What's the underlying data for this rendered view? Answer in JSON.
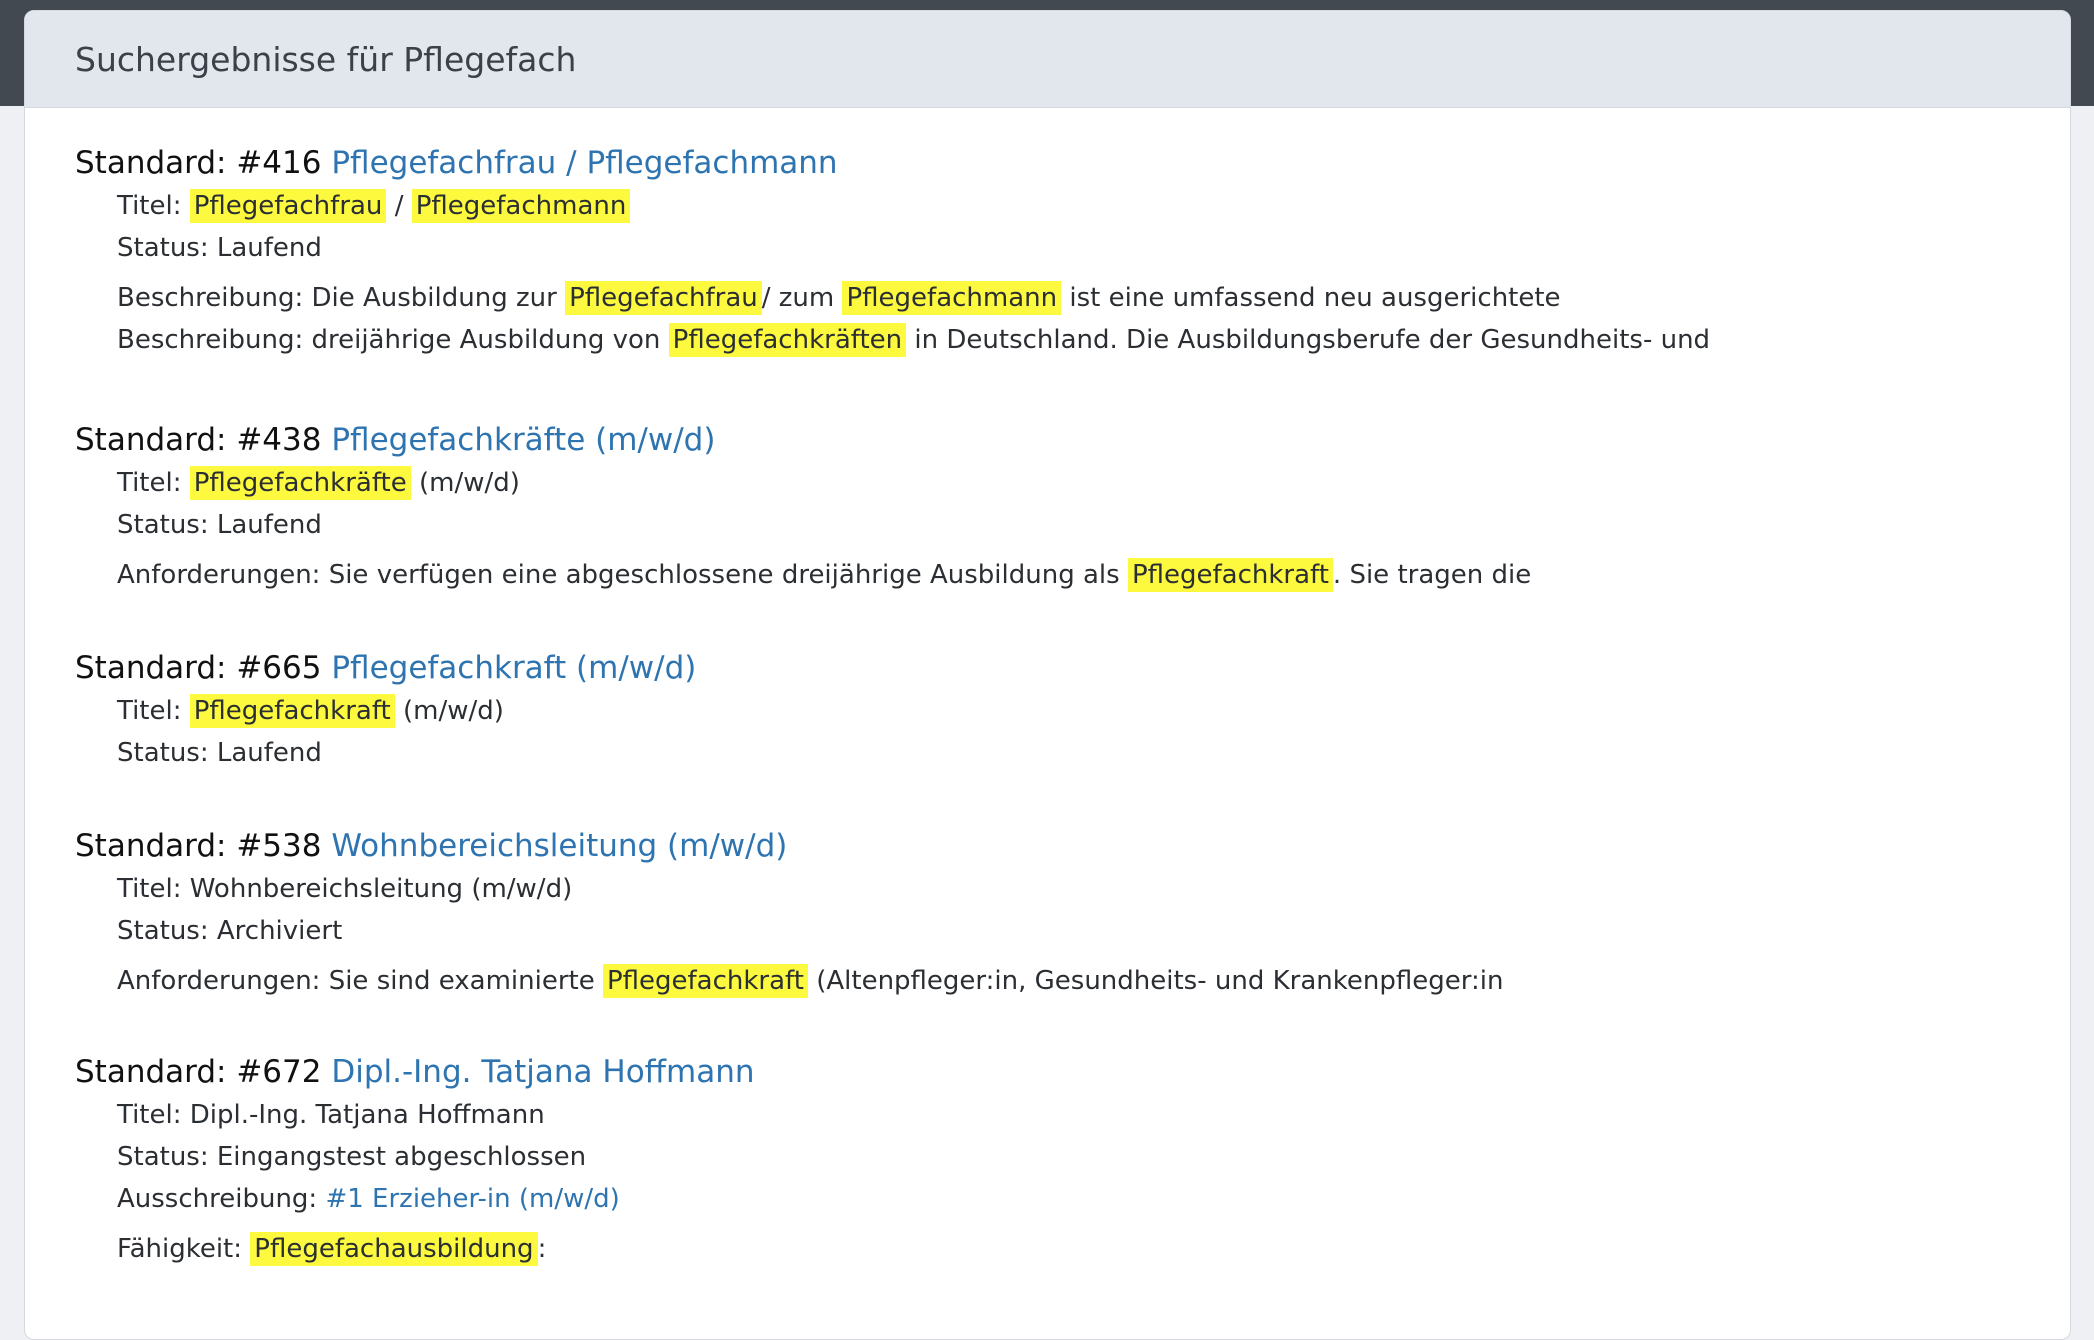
{
  "header": {
    "title": "Suchergebnisse für Pflegefach"
  },
  "results": [
    {
      "prefix": "Standard: #416",
      "link": "Pflegefachfrau / Pflegefachmann",
      "title_label": "Titel:",
      "title_hl1": "Pflegefachfrau",
      "title_sep": "/",
      "title_hl2": "Pflegefachmann",
      "status": "Status: Laufend",
      "desc1_a": "Beschreibung: Die Ausbildung zur",
      "desc1_hl1": "Pflegefachfrau",
      "desc1_b": "/ zum",
      "desc1_hl2": "Pflegefachmann",
      "desc1_c": "ist eine umfassend neu ausgerichtete",
      "desc2_a": "Beschreibung: dreijährige Ausbildung von",
      "desc2_hl": "Pflegefachkräften",
      "desc2_b": "in Deutschland. Die Ausbildungsberufe der Gesundheits- und"
    },
    {
      "prefix": "Standard: #438",
      "link": "Pflegefachkräfte (m/w/d)",
      "title_label": "Titel:",
      "title_hl": "Pflegefachkräfte",
      "title_rest": "(m/w/d)",
      "status": "Status: Laufend",
      "req_a": "Anforderungen: Sie verfügen eine abgeschlossene dreijährige Ausbildung als",
      "req_hl": "Pflegefachkraft",
      "req_b": ". Sie tragen die"
    },
    {
      "prefix": "Standard: #665",
      "link": "Pflegefachkraft (m/w/d)",
      "title_label": "Titel:",
      "title_hl": "Pflegefachkraft",
      "title_rest": "(m/w/d)",
      "status": "Status: Laufend"
    },
    {
      "prefix": "Standard: #538",
      "link": "Wohnbereichsleitung (m/w/d)",
      "title": "Titel: Wohnbereichsleitung (m/w/d)",
      "status": "Status: Archiviert",
      "req_a": "Anforderungen: Sie sind examinierte",
      "req_hl": "Pflegefachkraft",
      "req_b": "(Altenpfleger:in, Gesundheits- und Krankenpfleger:in"
    },
    {
      "prefix": "Standard: #672",
      "link": "Dipl.-Ing. Tatjana Hoffmann",
      "title": "Titel: Dipl.-Ing. Tatjana Hoffmann",
      "status": "Status: Eingangstest abgeschlossen",
      "ausschreibung_label": "Ausschreibung:",
      "ausschreibung_link": "#1 Erzieher-in (m/w/d)",
      "skill_label": "Fähigkeit:",
      "skill_hl": "Pflegefachausbildung",
      "skill_rest": ":"
    }
  ]
}
